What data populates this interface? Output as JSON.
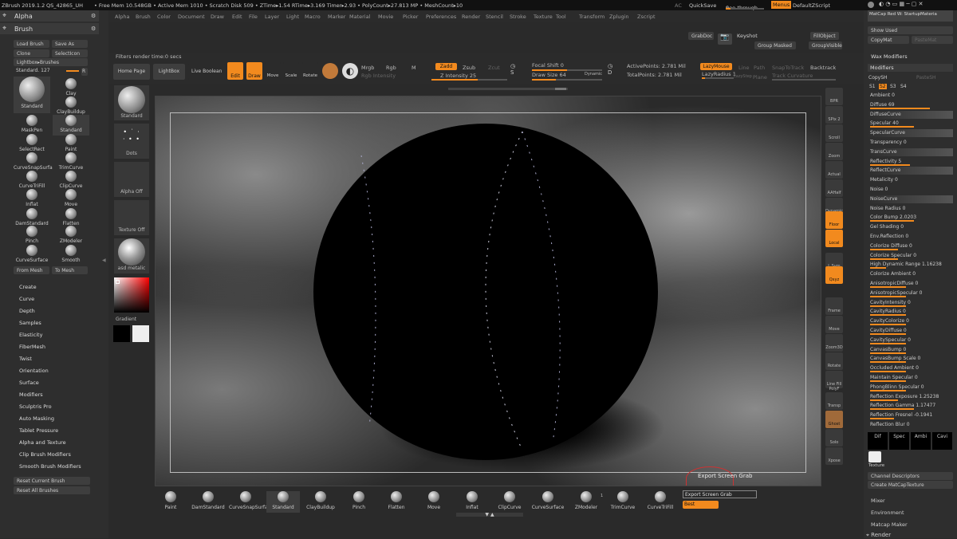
{
  "titlebar": {
    "app": "ZBrush 2019.1.2",
    "project": "QS_42865_UH",
    "stats": "• Free Mem 10.548GB • Active Mem 1010 • Scratch Disk 509 • ZTime▸1.54 RTime▸3.169 Timer▸2.93 • PolyCount▸27.813 MP • MeshCount▸10",
    "ac": "AC",
    "quicksave": "QuickSave",
    "see_through": "See-through",
    "see_through_value": "0",
    "menus": "Menus",
    "default_script": "DefaultZScript"
  },
  "menubar": [
    "Alpha",
    "Brush",
    "Color",
    "Document",
    "Draw",
    "Edit",
    "File",
    "Layer",
    "Light",
    "Macro",
    "Marker",
    "Material",
    "Movie",
    "Picker",
    "Preferences",
    "Render",
    "Stencil",
    "Stroke",
    "Texture",
    "Tool",
    "Transform",
    "Zplugin",
    "Zscript"
  ],
  "left_panel": {
    "alpha_title": "Alpha",
    "brush_title": "Brush",
    "load_brush": "Load Brush",
    "save_as": "Save As",
    "clone": "Clone",
    "select_icon": "SelectIcon",
    "lightbox_brushes": "Lightbox▸Brushes",
    "standard_label": "Standard.",
    "standard_value": "127",
    "r": "R",
    "brushes": [
      "Standard",
      "Clay",
      "ClayBuildup",
      "MaskPen",
      "Standard",
      "SelectRect",
      "Paint",
      "CurveSnapSurfa",
      "TrimCurve",
      "CurveTriFill",
      "ClipCurve",
      "Inflat",
      "Move",
      "DamStandard",
      "Flatten",
      "Pinch",
      "ZModeler",
      "CurveSurface",
      "Smooth"
    ],
    "from_mesh": "From Mesh",
    "to_mesh": "To Mesh",
    "menu_items": [
      "Create",
      "Curve",
      "Depth",
      "Samples",
      "Elasticity",
      "FiberMesh",
      "Twist",
      "Orientation",
      "Surface",
      "Modifiers",
      "Sculptris Pro",
      "Auto Masking",
      "Tablet Pressure",
      "Alpha and Texture",
      "Clip Brush Modifiers",
      "Smooth Brush Modifiers"
    ],
    "reset_current": "Reset Current Brush",
    "reset_all": "Reset All Brushes"
  },
  "topright": {
    "grabdoc": "GrabDoc",
    "keyshot": "Keyshot",
    "fillobject": "FillObject",
    "group_masked": "Group Masked",
    "group_visible": "GroupVisible"
  },
  "toolbar": {
    "filters": "Filters render time:0 secs",
    "home_page": "Home Page",
    "lightbox": "LightBox",
    "live_boolean": "Live Boolean",
    "edit": "Edit",
    "draw": "Draw",
    "move": "Move",
    "scale": "Scale",
    "rotate": "Rotate",
    "mrgb": "Mrgb",
    "rgb": "Rgb",
    "m": "M",
    "zadd": "Zadd",
    "zsub": "Zsub",
    "zcut": "Zcut",
    "rgb_intensity": "Rgb Intensity",
    "z_intensity": "Z Intensity 25",
    "focal_shift": "Focal Shift 0",
    "draw_size": "Draw Size 64",
    "dynamic": "Dynamic",
    "active_points": "ActivePoints: 2.781 Mil",
    "total_points": "TotalPoints: 2.781 Mil",
    "lazymouse": "LazyMouse",
    "lazyradius": "LazyRadius 1",
    "line": "Line",
    "path": "Path",
    "snaptotrack": "SnapToTrack",
    "backtrack": "Backtrack",
    "lazystep": "LazyStep",
    "plane": "Plane",
    "track_curvature": "Track Curvature"
  },
  "shelf": {
    "standard": "Standard",
    "dots": "Dots",
    "alpha_off": "Alpha Off",
    "texture_off": "Texture Off",
    "material": "asd metalic",
    "gradient": "Gradient"
  },
  "rightbar": [
    "BPR",
    "SPix 2",
    "Scroll",
    "Zoom",
    "Actual",
    "AAHalf",
    "Dynamic Persp",
    "Floor",
    "Local",
    "L.Sym",
    "Qxyz",
    "Frame",
    "Move",
    "Zoom3D",
    "Rotate",
    "Line Fill PolyF",
    "Transp",
    "Ghost",
    "Solo",
    "Xpose"
  ],
  "right_panel": {
    "matcap_name": "MatCap Red W: StartupMateria",
    "show_used": "Show Used",
    "copymat": "CopyMat",
    "pastemat": "PasteMat",
    "wax_modifiers": "Wax Modifiers",
    "modifiers": "Modifiers",
    "copysh": "CopySH",
    "pastesh": "PasteSH",
    "s_buttons": [
      "S1",
      "S2",
      "S3",
      "S4"
    ],
    "rows": [
      {
        "label": "Ambient 0",
        "fill": 0
      },
      {
        "label": "Diffuse 69",
        "fill": 0.75
      },
      {
        "label": "DiffuseCurve",
        "fill": 0
      },
      {
        "label": "Specular 40",
        "fill": 0.55
      },
      {
        "label": "SpecularCurve",
        "fill": 0
      },
      {
        "label": "Transparency 0",
        "fill": 0
      },
      {
        "label": "TransCurve",
        "fill": 0
      },
      {
        "label": "Reflectivity 5",
        "fill": 0.5
      },
      {
        "label": "ReflectCurve",
        "fill": 0
      },
      {
        "label": "Metalicity 0",
        "fill": 0
      },
      {
        "label": "Noise 0",
        "fill": 0
      },
      {
        "label": "NoiseCurve",
        "fill": 0
      },
      {
        "label": "Noise Radius 0",
        "fill": 0
      },
      {
        "label": "Color Bump 2.0203",
        "fill": 0.55
      },
      {
        "label": "Gel Shading 0",
        "fill": 0
      },
      {
        "label": "Env.Reflection 0",
        "fill": 0
      },
      {
        "label": "Colorize Diffuse 0",
        "fill": 0.35
      },
      {
        "label": "Colorize Specular 0",
        "fill": 0.35
      },
      {
        "label": "High Dynamic Range 1.16238",
        "fill": 0.2
      },
      {
        "label": "Colorize Ambient 0",
        "fill": 0
      },
      {
        "label": "AnisotropicDiffuse 0",
        "fill": 0.45
      },
      {
        "label": "AnisotropicSpecular 0",
        "fill": 0.45
      },
      {
        "label": "CavityIntensity 0",
        "fill": 0.45
      },
      {
        "label": "CavityRadius 0",
        "fill": 0.45
      },
      {
        "label": "CavityColorize 0",
        "fill": 0.45
      },
      {
        "label": "CavityDiffuse 0",
        "fill": 0.45
      },
      {
        "label": "CavitySpecular 0",
        "fill": 0.45
      },
      {
        "label": "CanvasBump 0",
        "fill": 0.45
      },
      {
        "label": "CanvasBump Scale 0",
        "fill": 0.45
      },
      {
        "label": "Occluded Ambient 0",
        "fill": 0.45
      },
      {
        "label": "Maintain Specular 0",
        "fill": 0.45
      },
      {
        "label": "PhongBlinn Specular 0",
        "fill": 0.45
      },
      {
        "label": "Reflection Exposure 1.25238",
        "fill": 0.35
      },
      {
        "label": "Reflection Gamma 1.17477",
        "fill": 0.55
      },
      {
        "label": "Reflection Fresnel -0.1941",
        "fill": 0.3
      },
      {
        "label": "Reflection Blur 0",
        "fill": 0
      }
    ],
    "texture_slots": [
      "Dif",
      "Spec",
      "Ambi",
      "Cavi"
    ],
    "texture": "Texture",
    "channel_descriptors": "Channel Descriptors",
    "create_matcap": "Create MatCapTexture",
    "mixer": "Mixer",
    "environment": "Environment",
    "matcap_maker": "Matcap Maker",
    "render": "Render"
  },
  "bottom_shelf": [
    "Paint",
    "DamStandard",
    "CurveSnapSurfa",
    "Standard",
    "ClayBuildup",
    "Pinch",
    "Flatten",
    "Move",
    "Inflat",
    "ClipCurve",
    "CurveSurface",
    "ZModeler",
    "TrimCurve",
    "CurveTriFill"
  ],
  "export": {
    "tooltip": "Export Screen Grab",
    "field": "Export Screen Grab",
    "quality": "Best",
    "one": "1"
  },
  "colors": {
    "accent": "#f28a1e",
    "panel": "#2e2e2e",
    "background": "#2a2a2a"
  }
}
